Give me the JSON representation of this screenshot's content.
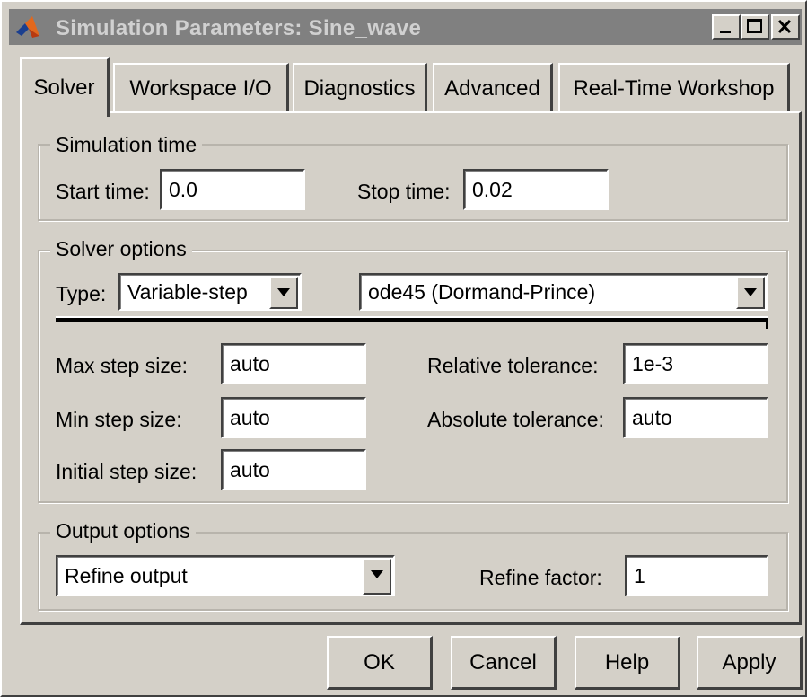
{
  "window": {
    "title": "Simulation Parameters: Sine_wave",
    "icon": "matlab-logo-icon",
    "controls": [
      "minimize-icon",
      "maximize-icon",
      "close-icon"
    ]
  },
  "tabs": [
    {
      "label": "Solver",
      "active": true
    },
    {
      "label": "Workspace I/O",
      "active": false
    },
    {
      "label": "Diagnostics",
      "active": false
    },
    {
      "label": "Advanced",
      "active": false
    },
    {
      "label": "Real-Time Workshop",
      "active": false
    }
  ],
  "simulation_time": {
    "legend": "Simulation time",
    "start_label": "Start time:",
    "start_value": "0.0",
    "stop_label": "Stop time:",
    "stop_value": "0.02"
  },
  "solver_options": {
    "legend": "Solver options",
    "type_label": "Type:",
    "type_value": "Variable-step",
    "solver_value": "ode45 (Dormand-Prince)",
    "max_step_label": "Max step size:",
    "max_step_value": "auto",
    "min_step_label": "Min step size:",
    "min_step_value": "auto",
    "initial_step_label": "Initial step size:",
    "initial_step_value": "auto",
    "rel_tol_label": "Relative tolerance:",
    "rel_tol_value": "1e-3",
    "abs_tol_label": "Absolute tolerance:",
    "abs_tol_value": "auto"
  },
  "output_options": {
    "legend": "Output options",
    "output_value": "Refine output",
    "refine_label": "Refine factor:",
    "refine_value": "1"
  },
  "buttons": {
    "ok": "OK",
    "cancel": "Cancel",
    "help": "Help",
    "apply": "Apply"
  }
}
